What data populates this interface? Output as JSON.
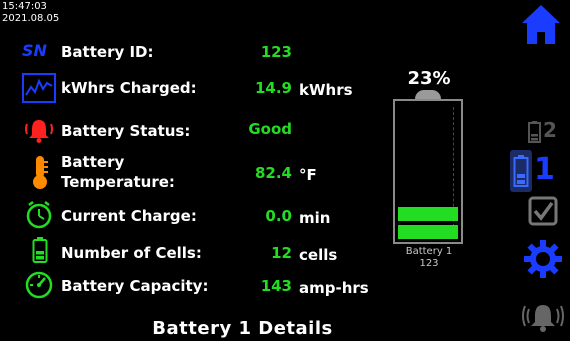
{
  "clock": {
    "time": "15:47:03",
    "date": "2021.08.05"
  },
  "rows": [
    {
      "label": "Battery ID:",
      "value": "123",
      "unit": "",
      "icon": "serial-number-icon"
    },
    {
      "label": "kWhrs Charged:",
      "value": "14.9",
      "unit": "kWhrs",
      "icon": "chart-icon"
    },
    {
      "label": "Battery Status:",
      "value": "Good",
      "unit": "",
      "icon": "alarm-bell-icon"
    },
    {
      "label_line1": "Battery",
      "label_line2": "Temperature:",
      "value": "82.4",
      "unit": "°F",
      "icon": "thermometer-icon"
    },
    {
      "label": "Current Charge:",
      "value": "0.0",
      "unit": "min",
      "icon": "clock-icon"
    },
    {
      "label": "Number of Cells:",
      "value": "12",
      "unit": "cells",
      "icon": "battery-cells-icon"
    },
    {
      "label": "Battery Capacity:",
      "value": "143",
      "unit": "amp-hrs",
      "icon": "gauge-icon"
    }
  ],
  "sn_badge": "SN",
  "battery": {
    "percent_text": "23%",
    "charge_fraction": 0.23,
    "name": "Battery 1",
    "id": "123"
  },
  "footer_title": "Battery 1 Details",
  "sidebar": {
    "battery2_label": "2",
    "battery1_label": "1"
  },
  "colors": {
    "value": "#22dd22",
    "accent": "#1a3cff",
    "alert": "#ff2020",
    "temp": "#ff8a00",
    "icon_green": "#22dd22"
  }
}
